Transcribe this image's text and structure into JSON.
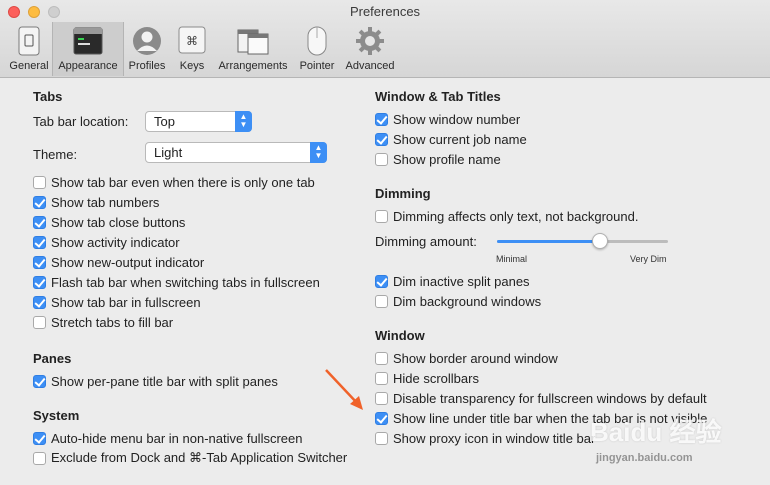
{
  "window": {
    "title": "Preferences"
  },
  "toolbar": {
    "items": [
      {
        "label": "General",
        "icon": "general-icon"
      },
      {
        "label": "Appearance",
        "icon": "appearance-icon",
        "selected": true
      },
      {
        "label": "Profiles",
        "icon": "profiles-icon"
      },
      {
        "label": "Keys",
        "icon": "keys-icon"
      },
      {
        "label": "Arrangements",
        "icon": "arrangements-icon"
      },
      {
        "label": "Pointer",
        "icon": "pointer-icon"
      },
      {
        "label": "Advanced",
        "icon": "advanced-icon"
      }
    ]
  },
  "tabs": {
    "heading": "Tabs",
    "location_label": "Tab bar location:",
    "location_value": "Top",
    "theme_label": "Theme:",
    "theme_value": "Light",
    "options": [
      {
        "label": "Show tab bar even when there is only one tab",
        "checked": false
      },
      {
        "label": "Show tab numbers",
        "checked": true
      },
      {
        "label": "Show tab close buttons",
        "checked": true
      },
      {
        "label": "Show activity indicator",
        "checked": true
      },
      {
        "label": "Show new-output indicator",
        "checked": true
      },
      {
        "label": "Flash tab bar when switching tabs in fullscreen",
        "checked": true
      },
      {
        "label": "Show tab bar in fullscreen",
        "checked": true
      },
      {
        "label": "Stretch tabs to fill bar",
        "checked": false
      }
    ]
  },
  "panes": {
    "heading": "Panes",
    "options": [
      {
        "label": "Show per-pane title bar with split panes",
        "checked": true
      }
    ]
  },
  "system": {
    "heading": "System",
    "options": [
      {
        "label": "Auto-hide menu bar in non-native fullscreen",
        "checked": true
      },
      {
        "label": "Exclude from Dock and ⌘-Tab Application Switcher",
        "checked": false
      }
    ]
  },
  "titles": {
    "heading": "Window & Tab Titles",
    "options": [
      {
        "label": "Show window number",
        "checked": true
      },
      {
        "label": "Show current job name",
        "checked": true
      },
      {
        "label": "Show profile name",
        "checked": false
      }
    ]
  },
  "dimming": {
    "heading": "Dimming",
    "only_text": {
      "label": "Dimming affects only text, not background.",
      "checked": false
    },
    "amount_label": "Dimming amount:",
    "amount_value": 0.6,
    "min_label": "Minimal",
    "max_label": "Very Dim",
    "options": [
      {
        "label": "Dim inactive split panes",
        "checked": true
      },
      {
        "label": "Dim background windows",
        "checked": false
      }
    ]
  },
  "window_section": {
    "heading": "Window",
    "options": [
      {
        "label": "Show border around window",
        "checked": false
      },
      {
        "label": "Hide scrollbars",
        "checked": false
      },
      {
        "label": "Disable transparency for fullscreen windows by default",
        "checked": false
      },
      {
        "label": "Show line under title bar when the tab bar is not visible",
        "checked": true
      },
      {
        "label": "Show proxy icon in window title bar",
        "checked": false
      }
    ]
  },
  "watermark": {
    "text": "Baidu 经验",
    "url": "jingyan.baidu.com"
  },
  "colors": {
    "accent": "#3d8ff5",
    "annotation_arrow": "#f0622a"
  }
}
